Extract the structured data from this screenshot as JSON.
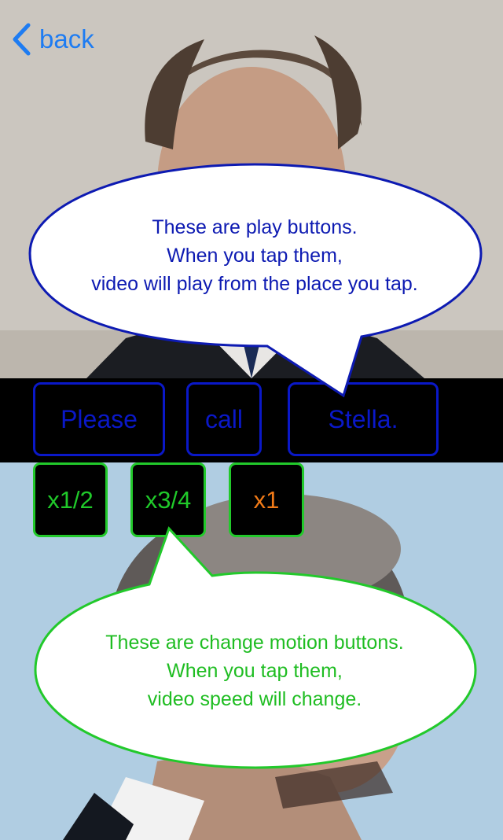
{
  "nav": {
    "back_label": "back"
  },
  "words": [
    {
      "label": "Please"
    },
    {
      "label": "call"
    },
    {
      "label": "Stella."
    }
  ],
  "speeds": [
    {
      "label": "x1/2"
    },
    {
      "label": "x3/4"
    },
    {
      "label": "x1",
      "active": true
    }
  ],
  "callouts": {
    "play": {
      "lines": [
        "These are play buttons.",
        "When you tap them,",
        "video will play from the place you tap."
      ]
    },
    "speed": {
      "lines": [
        "These are change motion buttons.",
        "When you tap them,",
        "video speed will change."
      ]
    }
  },
  "colors": {
    "play_accent": "#0a18c8",
    "speed_accent": "#22c92b",
    "active_speed_text": "#f07a17",
    "back_link": "#1e7cf2"
  }
}
